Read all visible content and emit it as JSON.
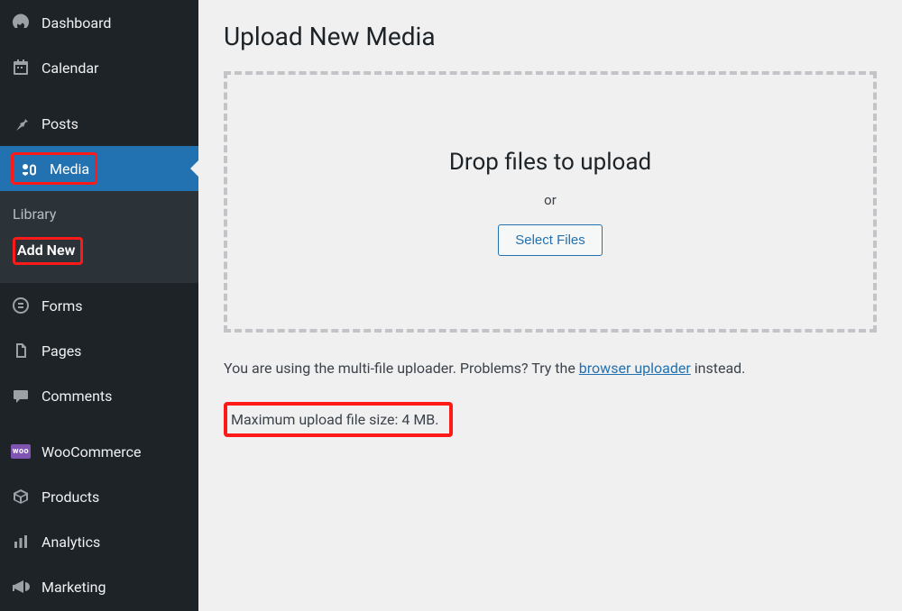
{
  "sidebar": {
    "items": [
      {
        "id": "dashboard",
        "label": "Dashboard",
        "icon": "gauge-icon"
      },
      {
        "id": "calendar",
        "label": "Calendar",
        "icon": "calendar-icon"
      },
      {
        "id": "posts",
        "label": "Posts",
        "icon": "pin-icon"
      },
      {
        "id": "media",
        "label": "Media",
        "icon": "media-icon",
        "current": true
      },
      {
        "id": "forms",
        "label": "Forms",
        "icon": "forms-icon"
      },
      {
        "id": "pages",
        "label": "Pages",
        "icon": "pages-icon"
      },
      {
        "id": "comments",
        "label": "Comments",
        "icon": "comment-icon"
      },
      {
        "id": "woocommerce",
        "label": "WooCommerce",
        "icon": "woo-icon"
      },
      {
        "id": "products",
        "label": "Products",
        "icon": "box-icon"
      },
      {
        "id": "analytics",
        "label": "Analytics",
        "icon": "bars-icon"
      },
      {
        "id": "marketing",
        "label": "Marketing",
        "icon": "megaphone-icon"
      }
    ],
    "submenu": {
      "library_label": "Library",
      "addnew_label": "Add New"
    },
    "woo_badge": "woo"
  },
  "page": {
    "title": "Upload New Media",
    "dropzone": {
      "headline": "Drop files to upload",
      "or_label": "or",
      "button_label": "Select Files"
    },
    "uploader_note_pre": "You are using the multi-file uploader. Problems? Try the ",
    "uploader_note_link": "browser uploader",
    "uploader_note_post": " instead.",
    "max_size_text": "Maximum upload file size: 4 MB."
  },
  "colors": {
    "accent": "#2271b1",
    "sidebar_bg": "#1d2327",
    "highlight_red": "#ff1a1a"
  }
}
